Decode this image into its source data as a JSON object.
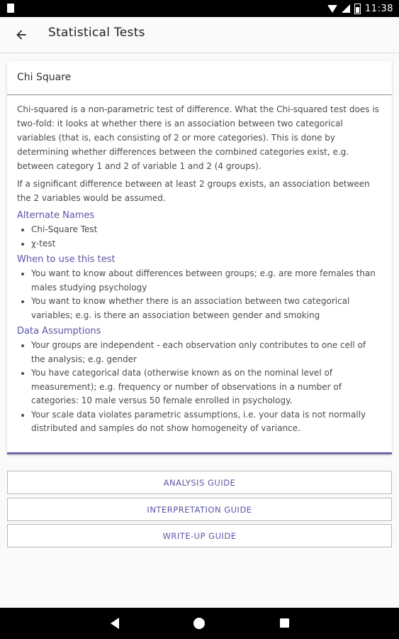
{
  "status_bar": {
    "time": "11:38"
  },
  "app_bar": {
    "title": "Statistical Tests"
  },
  "card": {
    "title": "Chi Square",
    "paragraphs": [
      "Chi-squared is a non-parametric test of difference. What the Chi-squared test does is two-fold: it looks at whether there is an association between two categorical variables (that is, each consisting of 2 or more categories). This is done by determining whether differences between the combined categories exist, e.g. between category 1 and 2 of variable 1 and 2 (4 groups).",
      "If a significant difference between at least 2 groups exists, an association between the 2 variables would be assumed."
    ],
    "alternate_names": {
      "heading": "Alternate Names",
      "items": [
        "Chi-Square Test",
        "χ-test"
      ]
    },
    "when_to_use": {
      "heading": "When to use this test",
      "items": [
        "You want to know about differences between groups; e.g. are more females than males studying psychology",
        "You want to know whether there is an association between two categorical variables; e.g. is there an association between gender and smoking"
      ]
    },
    "data_assumptions": {
      "heading": "Data Assumptions",
      "items": [
        "Your groups are independent - each observation only contributes to one cell of the analysis; e.g. gender",
        "You have categorical data (otherwise known as on the nominal level of measurement); e.g. frequency or number of observations in a number of categories: 10 male versus 50 female enrolled in psychology.",
        "Your scale data violates parametric assumptions, i.e. your data is not normally distributed and samples do not show homogeneity of variance."
      ]
    }
  },
  "buttons": {
    "analysis": "ANALYSIS GUIDE",
    "interpretation": "INTERPRETATION GUIDE",
    "writeup": "WRITE-UP GUIDE"
  },
  "colors": {
    "accent": "#5a55a6",
    "card_border": "#6e6aa6"
  }
}
